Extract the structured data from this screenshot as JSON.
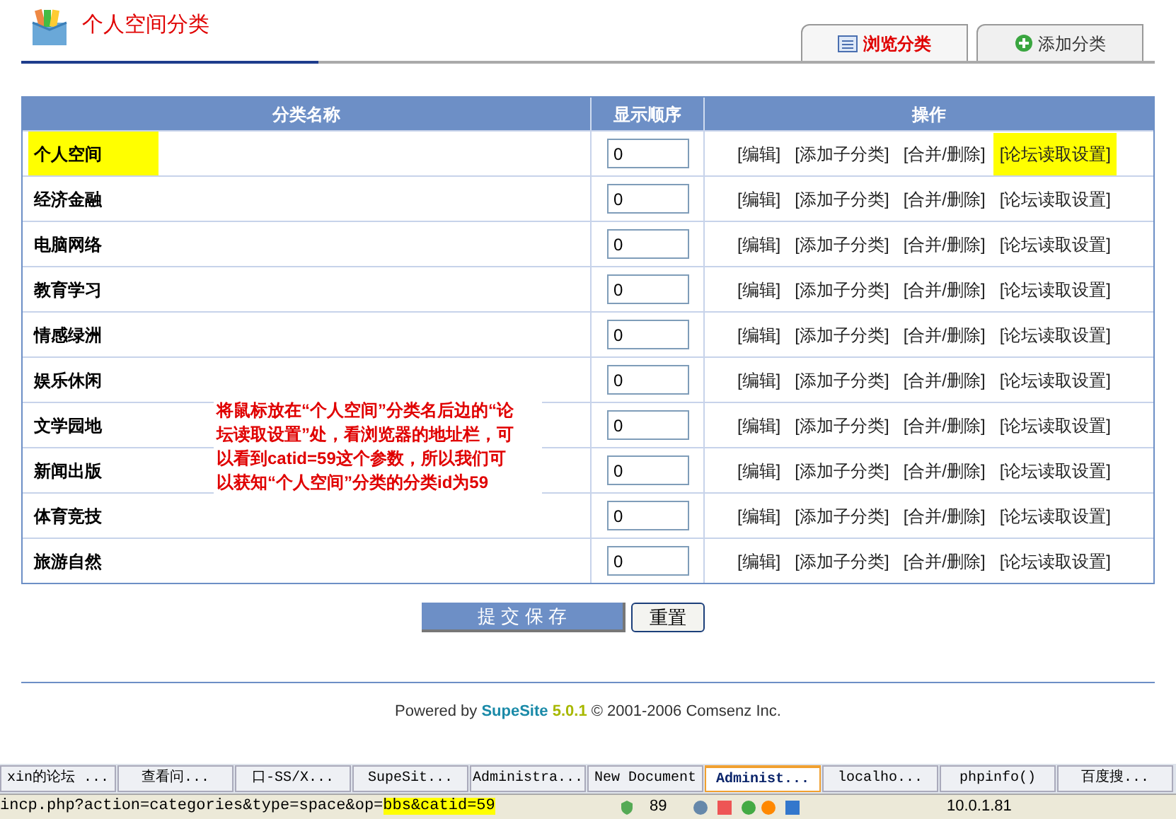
{
  "header": {
    "title": "个人空间分类",
    "tabs": [
      {
        "label": "浏览分类",
        "selected": true,
        "kind": "list"
      },
      {
        "label": "添加分类",
        "selected": false,
        "kind": "add"
      }
    ]
  },
  "table": {
    "columns": [
      "分类名称",
      "显示顺序",
      "操作"
    ],
    "rows": [
      {
        "name": "个人空间",
        "order": "0",
        "highlighted": true,
        "actions": [
          "[编辑]",
          "[添加子分类]",
          "[合并/删除]",
          "[论坛读取设置]"
        ]
      },
      {
        "name": "经济金融",
        "order": "0",
        "highlighted": false,
        "actions": [
          "[编辑]",
          "[添加子分类]",
          "[合并/删除]",
          "[论坛读取设置]"
        ]
      },
      {
        "name": "电脑网络",
        "order": "0",
        "highlighted": false,
        "actions": [
          "[编辑]",
          "[添加子分类]",
          "[合并/删除]",
          "[论坛读取设置]"
        ]
      },
      {
        "name": "教育学习",
        "order": "0",
        "highlighted": false,
        "actions": [
          "[编辑]",
          "[添加子分类]",
          "[合并/删除]",
          "[论坛读取设置]"
        ]
      },
      {
        "name": "情感绿洲",
        "order": "0",
        "highlighted": false,
        "actions": [
          "[编辑]",
          "[添加子分类]",
          "[合并/删除]",
          "[论坛读取设置]"
        ]
      },
      {
        "name": "娱乐休闲",
        "order": "0",
        "highlighted": false,
        "actions": [
          "[编辑]",
          "[添加子分类]",
          "[合并/删除]",
          "[论坛读取设置]"
        ]
      },
      {
        "name": "文学园地",
        "order": "0",
        "highlighted": false,
        "actions": [
          "[编辑]",
          "[添加子分类]",
          "[合并/删除]",
          "[论坛读取设置]"
        ]
      },
      {
        "name": "新闻出版",
        "order": "0",
        "highlighted": false,
        "actions": [
          "[编辑]",
          "[添加子分类]",
          "[合并/删除]",
          "[论坛读取设置]"
        ]
      },
      {
        "name": "体育竞技",
        "order": "0",
        "highlighted": false,
        "actions": [
          "[编辑]",
          "[添加子分类]",
          "[合并/删除]",
          "[论坛读取设置]"
        ]
      },
      {
        "name": "旅游自然",
        "order": "0",
        "highlighted": false,
        "actions": [
          "[编辑]",
          "[添加子分类]",
          "[合并/删除]",
          "[论坛读取设置]"
        ]
      }
    ]
  },
  "annotation": "将鼠标放在“个人空间”分类名后边的“论坛读取设置”处，看浏览器的地址栏，可以看到catid=59这个参数，所以我们可以获知“个人空间”分类的分类id为59",
  "buttons": {
    "submit": "提 交 保 存",
    "reset": "重置"
  },
  "footer": {
    "prefix": "Powered by",
    "brand": "SupeSite",
    "version": "5.0.1",
    "suffix": "© 2001-2006 Comsenz Inc."
  },
  "taskbar": [
    {
      "label": "xin的论坛 ...",
      "selected": false
    },
    {
      "label": "查看问...",
      "selected": false
    },
    {
      "label": "口-SS/X...",
      "selected": false
    },
    {
      "label": "SupeSit...",
      "selected": false
    },
    {
      "label": "Administra...",
      "selected": false
    },
    {
      "label": "New Document",
      "selected": false
    },
    {
      "label": "Administ...",
      "selected": true
    },
    {
      "label": "localho...",
      "selected": false
    },
    {
      "label": "phpinfo()",
      "selected": false
    },
    {
      "label": "百度搜...",
      "selected": false
    }
  ],
  "status_bar": {
    "url": "incp.php?action=categories&type=space&op=",
    "url_highlight": "bbs&catid=59",
    "count": "89",
    "ip": "10.0.1.81"
  }
}
